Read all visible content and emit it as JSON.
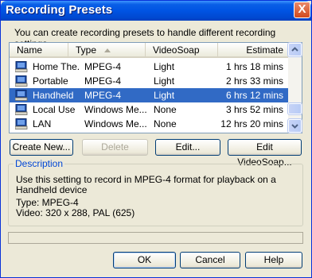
{
  "window": {
    "title": "Recording Presets",
    "close_glyph": "X"
  },
  "intro_text": "You can create recording presets to handle different recording settings.",
  "list": {
    "columns": {
      "name": "Name",
      "type": "Type",
      "videosoap": "VideoSoap",
      "estimate": "Estimate"
    },
    "rows": [
      {
        "name": "Home The...",
        "type": "MPEG-4",
        "videosoap": "Light",
        "estimate": "1 hrs 18 mins"
      },
      {
        "name": "Portable",
        "type": "MPEG-4",
        "videosoap": "Light",
        "estimate": "2 hrs 33 mins"
      },
      {
        "name": "Handheld",
        "type": "MPEG-4",
        "videosoap": "Light",
        "estimate": "6 hrs 12 mins"
      },
      {
        "name": "Local Use",
        "type": "Windows Me...",
        "videosoap": "None",
        "estimate": "3 hrs 52 mins"
      },
      {
        "name": "LAN",
        "type": "Windows Me...",
        "videosoap": "None",
        "estimate": "12 hrs 20 mins"
      }
    ],
    "selected_row": "Handheld"
  },
  "buttons": {
    "create_new": "Create New...",
    "delete": "Delete",
    "edit": "Edit...",
    "edit_videosoap": "Edit VideoSoap...",
    "ok": "OK",
    "cancel": "Cancel",
    "help": "Help"
  },
  "description": {
    "legend": "Description",
    "text": "Use this setting to record in MPEG-4 format for playback on a Handheld device",
    "type_line": "Type:  MPEG-4",
    "video_line": "Video:  320 x 288, PAL (625)"
  },
  "icons": {
    "row_icon": "computer-monitor-icon"
  },
  "colors": {
    "selection": "#316ac5",
    "titlebar": "#0054e3",
    "dialog_bg": "#ece9d8",
    "legend": "#0046d5"
  }
}
